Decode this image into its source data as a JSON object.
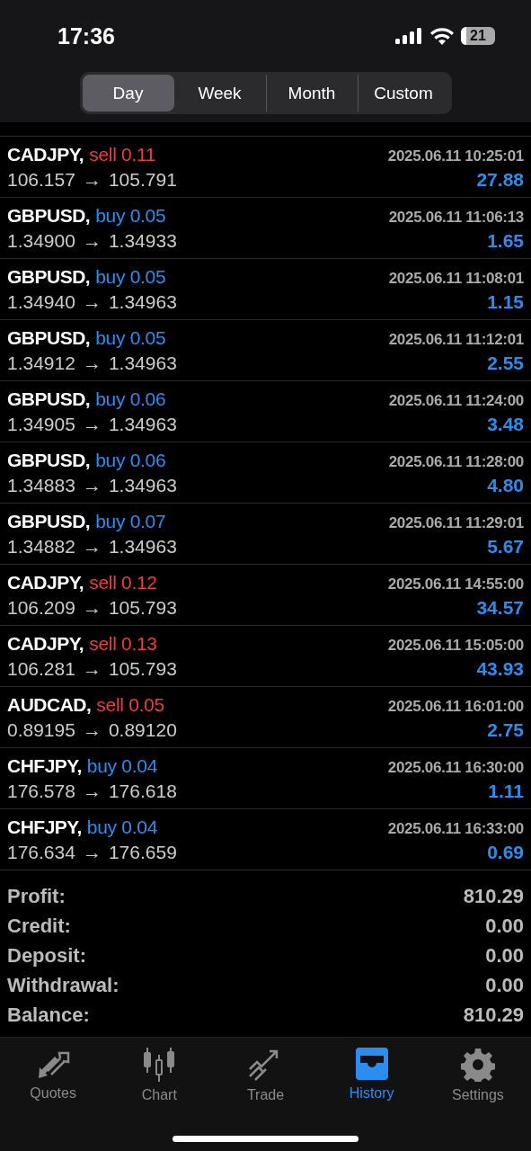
{
  "status_bar": {
    "time": "17:36",
    "battery": "21"
  },
  "periods": [
    {
      "label": "Day",
      "selected": true
    },
    {
      "label": "Week",
      "selected": false
    },
    {
      "label": "Month",
      "selected": false
    },
    {
      "label": "Custom",
      "selected": false
    }
  ],
  "deals": [
    {
      "symbol": "CADJPY,",
      "kind": "sell",
      "action": "sell 0.11",
      "time": "2025.06.11 10:25:01",
      "open": "106.157",
      "arrow": "→",
      "close": "105.791",
      "profit": "27.88"
    },
    {
      "symbol": "GBPUSD,",
      "kind": "buy",
      "action": "buy 0.05",
      "time": "2025.06.11 11:06:13",
      "open": "1.34900",
      "arrow": "→",
      "close": "1.34933",
      "profit": "1.65"
    },
    {
      "symbol": "GBPUSD,",
      "kind": "buy",
      "action": "buy 0.05",
      "time": "2025.06.11 11:08:01",
      "open": "1.34940",
      "arrow": "→",
      "close": "1.34963",
      "profit": "1.15"
    },
    {
      "symbol": "GBPUSD,",
      "kind": "buy",
      "action": "buy 0.05",
      "time": "2025.06.11 11:12:01",
      "open": "1.34912",
      "arrow": "→",
      "close": "1.34963",
      "profit": "2.55"
    },
    {
      "symbol": "GBPUSD,",
      "kind": "buy",
      "action": "buy 0.06",
      "time": "2025.06.11 11:24:00",
      "open": "1.34905",
      "arrow": "→",
      "close": "1.34963",
      "profit": "3.48"
    },
    {
      "symbol": "GBPUSD,",
      "kind": "buy",
      "action": "buy 0.06",
      "time": "2025.06.11 11:28:00",
      "open": "1.34883",
      "arrow": "→",
      "close": "1.34963",
      "profit": "4.80"
    },
    {
      "symbol": "GBPUSD,",
      "kind": "buy",
      "action": "buy 0.07",
      "time": "2025.06.11 11:29:01",
      "open": "1.34882",
      "arrow": "→",
      "close": "1.34963",
      "profit": "5.67"
    },
    {
      "symbol": "CADJPY,",
      "kind": "sell",
      "action": "sell 0.12",
      "time": "2025.06.11 14:55:00",
      "open": "106.209",
      "arrow": "→",
      "close": "105.793",
      "profit": "34.57"
    },
    {
      "symbol": "CADJPY,",
      "kind": "sell",
      "action": "sell 0.13",
      "time": "2025.06.11 15:05:00",
      "open": "106.281",
      "arrow": "→",
      "close": "105.793",
      "profit": "43.93"
    },
    {
      "symbol": "AUDCAD,",
      "kind": "sell",
      "action": "sell 0.05",
      "time": "2025.06.11 16:01:00",
      "open": "0.89195",
      "arrow": "→",
      "close": "0.89120",
      "profit": "2.75"
    },
    {
      "symbol": "CHFJPY,",
      "kind": "buy",
      "action": "buy 0.04",
      "time": "2025.06.11 16:30:00",
      "open": "176.578",
      "arrow": "→",
      "close": "176.618",
      "profit": "1.11"
    },
    {
      "symbol": "CHFJPY,",
      "kind": "buy",
      "action": "buy 0.04",
      "time": "2025.06.11 16:33:00",
      "open": "176.634",
      "arrow": "→",
      "close": "176.659",
      "profit": "0.69"
    }
  ],
  "summary": [
    {
      "label": "Profit:",
      "value": "810.29"
    },
    {
      "label": "Credit:",
      "value": "0.00"
    },
    {
      "label": "Deposit:",
      "value": "0.00"
    },
    {
      "label": "Withdrawal:",
      "value": "0.00"
    },
    {
      "label": "Balance:",
      "value": "810.29"
    }
  ],
  "tab_bar": [
    {
      "kind": "quotes",
      "label": "Quotes",
      "selected": false
    },
    {
      "kind": "chart",
      "label": "Chart",
      "selected": false
    },
    {
      "kind": "trade",
      "label": "Trade",
      "selected": false
    },
    {
      "kind": "history",
      "label": "History",
      "selected": true
    },
    {
      "kind": "settings",
      "label": "Settings",
      "selected": false
    }
  ]
}
